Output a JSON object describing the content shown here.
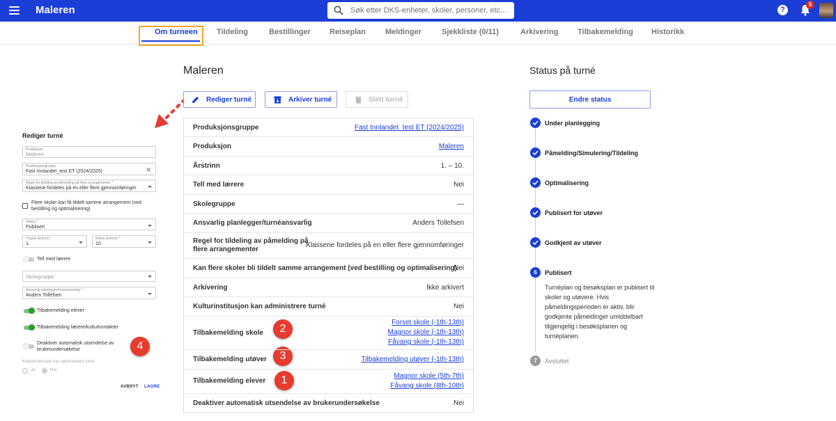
{
  "header": {
    "app_title": "Maleren",
    "search_placeholder": "Søk etter DKS-enheter, skoler, personer, etc...",
    "notification_count": "5",
    "help_glyph": "?"
  },
  "tabs": [
    {
      "label": "Om turneen",
      "active": true
    },
    {
      "label": "Tildeling"
    },
    {
      "label": "Bestillinger"
    },
    {
      "label": "Reiseplan"
    },
    {
      "label": "Meldinger"
    },
    {
      "label": "Sjekkliste (0/11)"
    },
    {
      "label": "Arkivering"
    },
    {
      "label": "Tilbakemelding"
    },
    {
      "label": "Historikk"
    }
  ],
  "form": {
    "title": "Rediger turné",
    "produksjon": {
      "label": "Produksjon",
      "value": "Maleren"
    },
    "produksjonsgruppe": {
      "label": "Produksjonsgruppe",
      "value": "Fast Innlandet_test ET (2024/2025)"
    },
    "regel": {
      "label": "Regel for tildeling av påmelding på flere arrangementer *",
      "value": "Klassene fordeles på en eller flere gjennomføringer"
    },
    "flere_skoler_label": "Flere skoler kan få tildelt samme arrangement (ved bestilling og optimalisering)",
    "status": {
      "label": "Status *",
      "value": "Publisert"
    },
    "yngste": {
      "label": "Yngste årstrinn *",
      "value": "1."
    },
    "eldste": {
      "label": "Eldste årstrinn *",
      "value": "10."
    },
    "tell_med_laerere": "Tell med lærere",
    "skolegrupper_placeholder": "Skolegrupper",
    "ansvarlig": {
      "label": "Ansvarlig planlegger/turnéansvarlig *",
      "value": "Anders  Tollefsen"
    },
    "tilbakemelding_elever": "Tilbakemelding elever",
    "tilbakemelding_laerere": "Tilbakemelding lærere/kulturkontakter",
    "deaktiver_label": "Deaktiver automatisk utsendelse av brukerundersøkelse",
    "kulturinstitusjon_label": "Kulturinstitusjon kan administrere turné",
    "radio_ja": "Ja",
    "radio_nei": "Nei",
    "cancel_label": "AVBRYT",
    "save_label": "LAGRE"
  },
  "callouts": {
    "one": "1",
    "two": "2",
    "three": "3",
    "four": "4"
  },
  "main": {
    "title": "Maleren",
    "edit_label": "Rediger turné",
    "archive_label": "Arkiver turné",
    "delete_label": "Slett turné",
    "rows": [
      {
        "label": "Produksjonsgruppe",
        "values": [
          "Fast Innlandet_test ET (2024/2025)"
        ],
        "link": true
      },
      {
        "label": "Produksjon",
        "values": [
          "Maleren"
        ],
        "link": true
      },
      {
        "label": "Årstrinn",
        "values": [
          "1. – 10."
        ]
      },
      {
        "label": "Tell med lærere",
        "values": [
          "Nei"
        ]
      },
      {
        "label": "Skolegruppe",
        "values": [
          "—"
        ]
      },
      {
        "label": "Ansvarlig planlegger/turnéansvarlig",
        "values": [
          "Anders Tollefsen"
        ]
      },
      {
        "label": "Regel for tildeling av påmelding på flere arrangementer",
        "values": [
          "Klassene fordeles på en eller flere gjennomføringer"
        ]
      },
      {
        "label": "Kan flere skoler bli tildelt samme arrangement (ved bestilling og optimalisering)",
        "values": [
          "Nei"
        ]
      },
      {
        "label": "Arkivering",
        "values": [
          "Ikke arkivert"
        ]
      },
      {
        "label": "Kulturinstitusjon kan administrere turné",
        "values": [
          "Nei"
        ]
      },
      {
        "label": "Tilbakemelding skole",
        "values": [
          "Forset skole (-1th-13th)",
          "Magnor skole (-1th-13th)",
          "Fåvang skole (-1th-13th)"
        ],
        "link": true
      },
      {
        "label": "Tilbakemelding utøver",
        "values": [
          "Tilbakemelding utøver (-1th-13th)"
        ],
        "link": true
      },
      {
        "label": "Tilbakemelding elever",
        "values": [
          "Magnor skole (5th-7th)",
          "Fåvang skole (8th-10th)"
        ],
        "link": true
      },
      {
        "label": "Deaktiver automatisk utsendelse av brukerundersøkelse",
        "values": [
          "Nei"
        ]
      }
    ]
  },
  "status": {
    "title": "Status på turné",
    "button_label": "Endre status",
    "steps": [
      {
        "label": "Under planlegging",
        "state": "done"
      },
      {
        "label": "Påmelding/Simulering/Tildeling",
        "state": "done"
      },
      {
        "label": "Optimalisering",
        "state": "done"
      },
      {
        "label": "Publisert for utøver",
        "state": "done"
      },
      {
        "label": "Godkjent av utøver",
        "state": "done"
      },
      {
        "label": "Publisert",
        "state": "current",
        "number": "6"
      },
      {
        "label": "Avsluttet",
        "state": "pending",
        "number": "7"
      }
    ],
    "current_description": "Turnéplan og besøksplan er publisert til skoler og utøvere. Hvis påmeldingsperioden er aktiv, blir godkjente påmeldinger umiddelbart tilgjengelig i besøksplanen og turnéplanen."
  },
  "colors": {
    "primary": "#1a3ed6",
    "callout": "#e63b2e",
    "highlight": "#f5a623",
    "toggle_on": "#2e9c33"
  }
}
